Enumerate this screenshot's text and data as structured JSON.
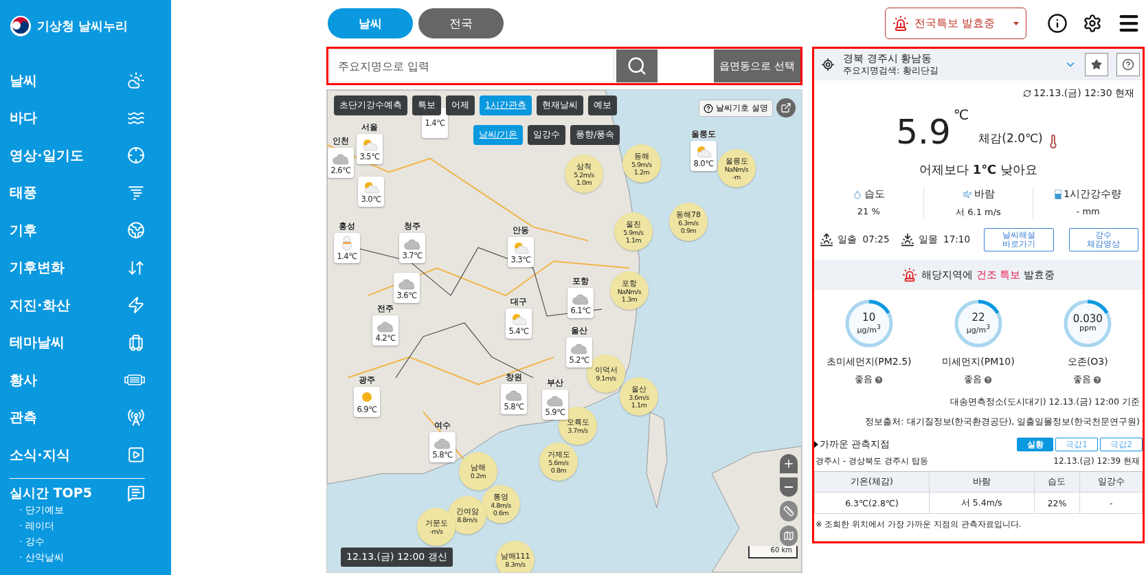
{
  "sidebar": {
    "logo": "기상청 날씨누리",
    "items": [
      {
        "label": "날씨"
      },
      {
        "label": "바다"
      },
      {
        "label": "영상·일기도"
      },
      {
        "label": "태풍"
      },
      {
        "label": "기후"
      },
      {
        "label": "기후변화"
      },
      {
        "label": "지진·화산"
      },
      {
        "label": "테마날씨"
      },
      {
        "label": "황사"
      },
      {
        "label": "관측"
      },
      {
        "label": "소식·지식"
      }
    ],
    "top5": {
      "title": "실시간 TOP5",
      "items": [
        "· 단기예보",
        "· 레이더",
        "· 강수",
        "· 산악날씨"
      ]
    }
  },
  "tabs": [
    {
      "label": "날씨",
      "selected": true
    },
    {
      "label": "전국",
      "selected": false
    }
  ],
  "alert_button": "전국특보 발효중",
  "search": {
    "placeholder": "주요지명으로 입력",
    "select_button": "읍면동으로 선택"
  },
  "map": {
    "layer_tabs": [
      {
        "label": "초단기강수예측",
        "selected": false
      },
      {
        "label": "특보",
        "selected": false
      },
      {
        "label": "어제",
        "selected": false
      },
      {
        "label": "1시간관측",
        "selected": true
      },
      {
        "label": "현재날씨",
        "selected": false
      },
      {
        "label": "예보",
        "selected": false
      }
    ],
    "sub_tabs": [
      {
        "label": "날씨/기온",
        "selected": true
      },
      {
        "label": "일강수",
        "selected": false
      },
      {
        "label": "풍향/풍속",
        "selected": false
      }
    ],
    "legend_button": "날씨기호 설명",
    "stations": [
      {
        "temp": "1.4℃"
      },
      {
        "name": "인천",
        "temp": "2.6℃",
        "kind": "cloudy"
      },
      {
        "name": "서울",
        "temp": "3.5℃",
        "kind": "partly"
      },
      {
        "temp": "3.0℃",
        "kind": "partly"
      },
      {
        "name": "홍성",
        "temp": "1.4℃",
        "kind": "snow"
      },
      {
        "name": "청주",
        "temp": "3.7℃",
        "kind": "cloudy"
      },
      {
        "temp": "3.6℃",
        "kind": "cloudy"
      },
      {
        "name": "안동",
        "temp": "3.3℃",
        "kind": "partly"
      },
      {
        "name": "울릉도",
        "temp": "8.0℃",
        "kind": "partly"
      },
      {
        "name": "포항",
        "temp": "6.1℃",
        "kind": "cloudy"
      },
      {
        "name": "전주",
        "temp": "4.2℃",
        "kind": "cloudy"
      },
      {
        "name": "대구",
        "temp": "5.4℃",
        "kind": "partly"
      },
      {
        "name": "울산",
        "temp": "5.2℃",
        "kind": "cloudy"
      },
      {
        "name": "광주",
        "temp": "6.9℃",
        "kind": "sunny"
      },
      {
        "name": "창원",
        "temp": "5.8℃",
        "kind": "cloudy"
      },
      {
        "name": "부산",
        "temp": "5.9℃",
        "kind": "cloudy"
      },
      {
        "name": "여수",
        "temp": "5.8℃",
        "kind": "cloudy"
      }
    ],
    "sea_stations": [
      {
        "name": "삼척",
        "wind": "5.2m/s",
        "wave": "1.0m"
      },
      {
        "name": "동해",
        "wind": "5.9m/s",
        "wave": "1.2m"
      },
      {
        "name": "울릉도",
        "wind": "NaNm/s",
        "wave": "-m"
      },
      {
        "name": "울진",
        "wind": "5.9m/s",
        "wave": "1.1m"
      },
      {
        "name": "동해78",
        "wind": "6.3m/s",
        "wave": "0.9m"
      },
      {
        "name": "포항",
        "wind": "NaNm/s",
        "wave": "1.3m"
      },
      {
        "name": "이덕서",
        "wind": "9.1m/s"
      },
      {
        "name": "울산",
        "wind": "3.6m/s",
        "wave": "1.1m"
      },
      {
        "name": "오륙도",
        "wind": "3.7m/s"
      },
      {
        "name": "거제도",
        "wind": "5.6m/s",
        "wave": "0.8m"
      },
      {
        "name": "남해",
        "wave": "0.2m"
      },
      {
        "name": "통영",
        "wind": "4.8m/s",
        "wave": "0.6m"
      },
      {
        "name": "간여암",
        "wind": "8.8m/s"
      },
      {
        "name": "거문도",
        "wind": "-m/s"
      },
      {
        "name": "남해111",
        "wind": "8.3m/s"
      }
    ],
    "updated": "12.13.(금) 12:00 갱신",
    "scale": "60 km"
  },
  "panel": {
    "location": {
      "title": "경북 경주시 황남동",
      "subtitle": "주요지명검색: 황리단길"
    },
    "time": "12.13.(금) 12:30 현재",
    "temp": "5.9",
    "temp_unit": "℃",
    "feels": "체감(2.0℃)",
    "compare": "어제보다 **1℃** 낮아요",
    "stats": [
      {
        "label": "습도",
        "value": "21 %"
      },
      {
        "label": "바람",
        "value": "서 6.1 m/s"
      },
      {
        "label": "1시간강수량",
        "value": "- mm"
      }
    ],
    "sun": [
      {
        "label": "일출",
        "time": "07:25"
      },
      {
        "label": "일몰",
        "time": "17:10"
      }
    ],
    "links": [
      "날씨해설\n바로가기",
      "강수\n체감영상"
    ],
    "alert": "해당지역에 **건조 특보** 발효중",
    "air": [
      {
        "value": "10",
        "unit": "µg/m$^{3}$",
        "name": "초미세먼지(PM2.5)",
        "grade": "좋음",
        "level": 0.17
      },
      {
        "value": "22",
        "unit": "µg/m$^{3}$",
        "name": "미세먼지(PM10)",
        "grade": "좋음",
        "level": 0.17
      },
      {
        "value": "0.030",
        "unit": "ppm",
        "name": "오존(O3)",
        "grade": "좋음",
        "level": 0.17
      }
    ],
    "air_station": "대송면측정소(도시대기) 12.13.(금) 12:00 기준",
    "source": "정보출처: 대기질정보(한국환경공단), 일출일몰정보(한국천문연구원)",
    "nearby": {
      "title": "가까운 관측지점",
      "tabs": [
        {
          "label": "실황",
          "selected": true
        },
        {
          "label": "극값1",
          "selected": false
        },
        {
          "label": "극값2",
          "selected": false
        }
      ],
      "station": "경주시 - 경상북도 경주시 탑동",
      "time": "12.13.(금) 12:39 현재",
      "columns": [
        "기온(체감)",
        "바람",
        "습도",
        "일강수"
      ],
      "row": [
        "6.3℃(2.8℃)",
        "서 5.4m/s",
        "22%",
        "-"
      ],
      "note": "※ 조회한 위치에서 가장 가까운 지점의 관측자료입니다."
    }
  }
}
